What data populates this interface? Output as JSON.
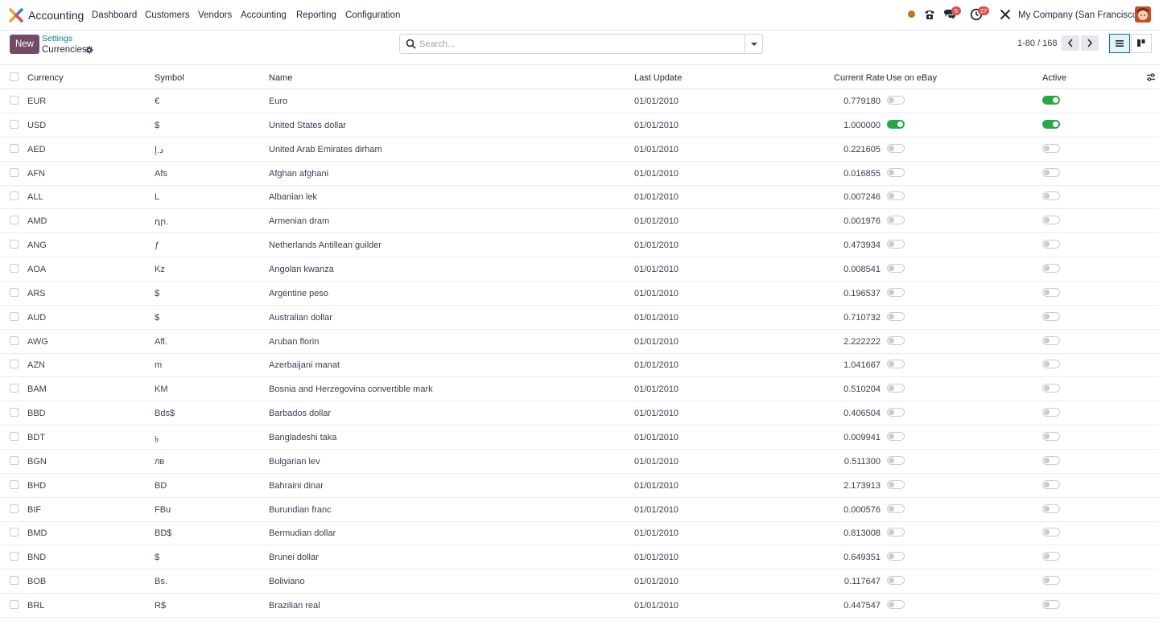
{
  "navbar": {
    "app_name": "Accounting",
    "menu": [
      "Dashboard",
      "Customers",
      "Vendors",
      "Accounting",
      "Reporting",
      "Configuration"
    ],
    "messages_count": "5",
    "activities_count": "27",
    "company": "My Company (San Francisco)"
  },
  "control": {
    "new_label": "New",
    "breadcrumb_parent": "Settings",
    "breadcrumb_current": "Currencies",
    "search_placeholder": "Search...",
    "pager": "1-80 / 168"
  },
  "table": {
    "columns": [
      "Currency",
      "Symbol",
      "Name",
      "Last Update",
      "Current Rate",
      "Use on eBay",
      "Active"
    ],
    "rows": [
      {
        "currency": "EUR",
        "symbol": "€",
        "name": "Euro",
        "last_update": "01/01/2010",
        "rate": "0.779180",
        "ebay": false,
        "active": true
      },
      {
        "currency": "USD",
        "symbol": "$",
        "name": "United States dollar",
        "last_update": "01/01/2010",
        "rate": "1.000000",
        "ebay": true,
        "active": true
      },
      {
        "currency": "AED",
        "symbol": "د.إ",
        "name": "United Arab Emirates dirham",
        "last_update": "01/01/2010",
        "rate": "0.221605",
        "ebay": false,
        "active": false
      },
      {
        "currency": "AFN",
        "symbol": "Afs",
        "name": "Afghan afghani",
        "last_update": "01/01/2010",
        "rate": "0.016855",
        "ebay": false,
        "active": false
      },
      {
        "currency": "ALL",
        "symbol": "L",
        "name": "Albanian lek",
        "last_update": "01/01/2010",
        "rate": "0.007246",
        "ebay": false,
        "active": false
      },
      {
        "currency": "AMD",
        "symbol": "դր.",
        "name": "Armenian dram",
        "last_update": "01/01/2010",
        "rate": "0.001976",
        "ebay": false,
        "active": false
      },
      {
        "currency": "ANG",
        "symbol": "ƒ",
        "name": "Netherlands Antillean guilder",
        "last_update": "01/01/2010",
        "rate": "0.473934",
        "ebay": false,
        "active": false
      },
      {
        "currency": "AOA",
        "symbol": "Kz",
        "name": "Angolan kwanza",
        "last_update": "01/01/2010",
        "rate": "0.008541",
        "ebay": false,
        "active": false
      },
      {
        "currency": "ARS",
        "symbol": "$",
        "name": "Argentine peso",
        "last_update": "01/01/2010",
        "rate": "0.196537",
        "ebay": false,
        "active": false
      },
      {
        "currency": "AUD",
        "symbol": "$",
        "name": "Australian dollar",
        "last_update": "01/01/2010",
        "rate": "0.710732",
        "ebay": false,
        "active": false
      },
      {
        "currency": "AWG",
        "symbol": "Afl.",
        "name": "Aruban florin",
        "last_update": "01/01/2010",
        "rate": "2.222222",
        "ebay": false,
        "active": false
      },
      {
        "currency": "AZN",
        "symbol": "m",
        "name": "Azerbaijani manat",
        "last_update": "01/01/2010",
        "rate": "1.041667",
        "ebay": false,
        "active": false
      },
      {
        "currency": "BAM",
        "symbol": "KM",
        "name": "Bosnia and Herzegovina convertible mark",
        "last_update": "01/01/2010",
        "rate": "0.510204",
        "ebay": false,
        "active": false
      },
      {
        "currency": "BBD",
        "symbol": "Bds$",
        "name": "Barbados dollar",
        "last_update": "01/01/2010",
        "rate": "0.406504",
        "ebay": false,
        "active": false
      },
      {
        "currency": "BDT",
        "symbol": "৳",
        "name": "Bangladeshi taka",
        "last_update": "01/01/2010",
        "rate": "0.009941",
        "ebay": false,
        "active": false
      },
      {
        "currency": "BGN",
        "symbol": "лв",
        "name": "Bulgarian lev",
        "last_update": "01/01/2010",
        "rate": "0.511300",
        "ebay": false,
        "active": false
      },
      {
        "currency": "BHD",
        "symbol": "BD",
        "name": "Bahraini dinar",
        "last_update": "01/01/2010",
        "rate": "2.173913",
        "ebay": false,
        "active": false
      },
      {
        "currency": "BIF",
        "symbol": "FBu",
        "name": "Burundian franc",
        "last_update": "01/01/2010",
        "rate": "0.000576",
        "ebay": false,
        "active": false
      },
      {
        "currency": "BMD",
        "symbol": "BD$",
        "name": "Bermudian dollar",
        "last_update": "01/01/2010",
        "rate": "0.813008",
        "ebay": false,
        "active": false
      },
      {
        "currency": "BND",
        "symbol": "$",
        "name": "Brunei dollar",
        "last_update": "01/01/2010",
        "rate": "0.649351",
        "ebay": false,
        "active": false
      },
      {
        "currency": "BOB",
        "symbol": "Bs.",
        "name": "Boliviano",
        "last_update": "01/01/2010",
        "rate": "0.117647",
        "ebay": false,
        "active": false
      },
      {
        "currency": "BRL",
        "symbol": "R$",
        "name": "Brazilian real",
        "last_update": "01/01/2010",
        "rate": "0.447547",
        "ebay": false,
        "active": false
      }
    ]
  }
}
